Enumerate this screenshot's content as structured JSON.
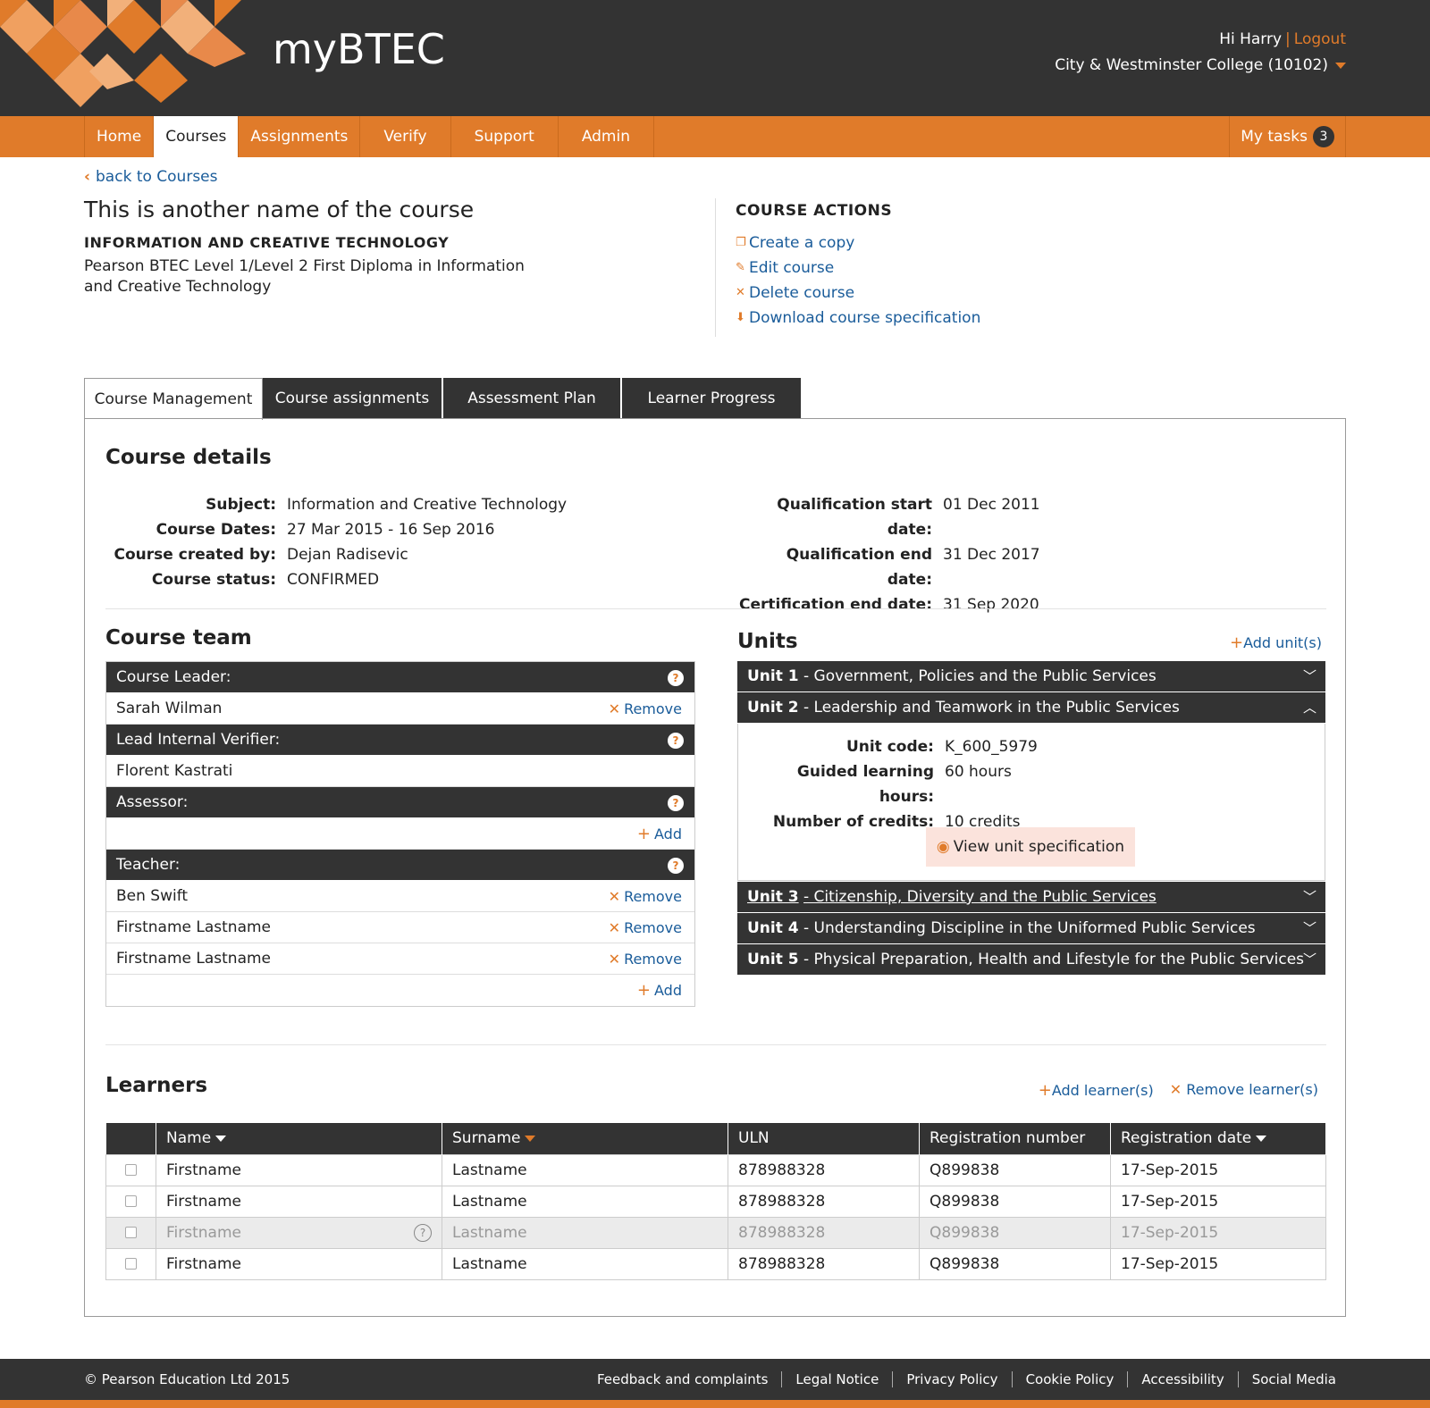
{
  "brand": "myBTEC",
  "user": {
    "greeting": "Hi Harry",
    "logout": "Logout",
    "college": "City & Westminster College (10102)"
  },
  "nav": {
    "items": [
      "Home",
      "Courses",
      "Assignments",
      "Verify",
      "Support",
      "Admin"
    ],
    "active": "Courses",
    "mytasks": "My tasks",
    "mytasks_count": "3"
  },
  "back_link": "back to Courses",
  "course": {
    "title": "This is another name of the course",
    "subject_caps": "INFORMATION AND CREATIVE TECHNOLOGY",
    "description": "Pearson BTEC Level 1/Level 2 First Diploma in Information and Creative Technology"
  },
  "course_actions": {
    "heading": "COURSE ACTIONS",
    "items": [
      "Create a copy",
      "Edit course",
      "Delete course",
      "Download course specification"
    ]
  },
  "tabs": [
    "Course Management",
    "Course assignments",
    "Assessment Plan",
    "Learner Progress"
  ],
  "details": {
    "heading": "Course details",
    "left": [
      {
        "k": "Subject:",
        "v": "Information and Creative Technology"
      },
      {
        "k": "Course Dates:",
        "v": "27 Mar 2015 - 16 Sep 2016"
      },
      {
        "k": "Course created by:",
        "v": "Dejan Radisevic"
      },
      {
        "k": "Course status:",
        "v": "CONFIRMED"
      }
    ],
    "right": [
      {
        "k": "Qualification start date:",
        "v": "01 Dec 2011"
      },
      {
        "k": "Qualification end date:",
        "v": "31 Dec 2017"
      },
      {
        "k": "Certification end date:",
        "v": "31 Sep 2020"
      }
    ]
  },
  "team": {
    "heading": "Course team",
    "leader_label": "Course Leader:",
    "leader": "Sarah Wilman",
    "liv_label": "Lead Internal Verifier:",
    "liv": "Florent Kastrati",
    "assessor_label": "Assessor:",
    "teacher_label": "Teacher:",
    "teachers": [
      "Ben Swift",
      "Firstname Lastname",
      "Firstname Lastname"
    ],
    "remove": "Remove",
    "add": "Add"
  },
  "units": {
    "heading": "Units",
    "add": "Add unit(s)",
    "list": [
      {
        "num": "Unit 1",
        "title": "- Government, Policies and the Public Services"
      },
      {
        "num": "Unit 2",
        "title": "- Leadership and Teamwork in the Public Services"
      },
      {
        "num": "Unit 3",
        "title": "- Citizenship, Diversity and the Public Services"
      },
      {
        "num": "Unit 4",
        "title": "- Understanding Discipline in the Uniformed Public Services"
      },
      {
        "num": "Unit 5",
        "title": "- Physical Preparation, Health and Lifestyle for the Public Services"
      }
    ],
    "expanded": {
      "code_label": "Unit code:",
      "code": "K_600_5979",
      "glh_label": "Guided learning hours:",
      "glh": "60 hours",
      "credits_label": "Number of credits:",
      "credits": "10 credits",
      "view_spec": "View unit specification"
    }
  },
  "learners": {
    "heading": "Learners",
    "add": "Add learner(s)",
    "remove": "Remove learner(s)",
    "columns": [
      "Name",
      "Surname",
      "ULN",
      "Registration number",
      "Registration date"
    ],
    "rows": [
      {
        "name": "Firstname",
        "surname": "Lastname",
        "uln": "878988328",
        "reg": "Q899838",
        "date": "17-Sep-2015"
      },
      {
        "name": "Firstname",
        "surname": "Lastname",
        "uln": "878988328",
        "reg": "Q899838",
        "date": "17-Sep-2015"
      },
      {
        "name": "Firstname",
        "surname": "Lastname",
        "uln": "878988328",
        "reg": "Q899838",
        "date": "17-Sep-2015"
      },
      {
        "name": "Firstname",
        "surname": "Lastname",
        "uln": "878988328",
        "reg": "Q899838",
        "date": "17-Sep-2015"
      }
    ]
  },
  "footer": {
    "copyright": "© Pearson Education Ltd 2015",
    "links": [
      "Feedback and complaints",
      "Legal Notice",
      "Privacy Policy",
      "Cookie Policy",
      "Accessibility",
      "Social Media"
    ]
  },
  "colors": {
    "accent": "#e07b2a",
    "dark": "#333333",
    "link": "#1a5c9a"
  }
}
